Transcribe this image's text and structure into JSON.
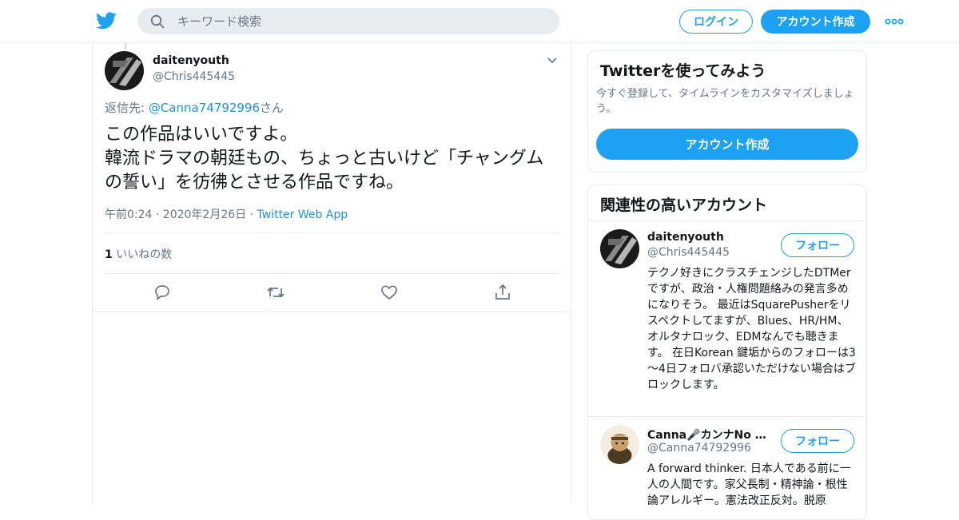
{
  "header": {
    "search_placeholder": "キーワード検索",
    "login_label": "ログイン",
    "signup_label": "アカウント作成"
  },
  "tweet": {
    "author_name": "daitenyouth",
    "author_handle": "@Chris445445",
    "reply_prefix": "返信先: ",
    "reply_mention": "@Canna74792996",
    "reply_suffix": "さん",
    "text": "この作品はいいですよ。\n韓流ドラマの朝廷もの、ちょっと古いけど「チャングムの誓い」を彷彿とさせる作品ですね。",
    "timestamp": "午前0:24 · 2020年2月26日 · ",
    "via": "Twitter Web App",
    "like_count": "1",
    "like_label": " いいねの数"
  },
  "signup_card": {
    "title": "Twitterを使ってみよう",
    "description": "今すぐ登録して、タイムラインをカスタマイズしましょう。",
    "button_label": "アカウント作成"
  },
  "related": {
    "title": "関連性の高いアカウント",
    "accounts": [
      {
        "name": "daitenyouth",
        "handle": "@Chris445445",
        "follow_label": "フォロー",
        "bio": "テクノ好きにクラスチェンジしたDTMerですが、政治・人権問題絡みの発言多めになりそう。 最近はSquarePusherをリスペクトしてますが、Blues、HR/HM、オルタナロック、EDMなんでも聴きます。 在日Korean 鍵垢からのフォローは3～4日フォロバ承認いただけない場合はブロックします。"
      },
      {
        "name": "Canna🎤カンナNo 安倍",
        "handle": "@Canna74792996",
        "follow_label": "フォロー",
        "bio": "A forward thinker. 日本人である前に一人の人間です。家父長制・精神論・根性論アレルギー。憲法改正反対。脱原"
      }
    ]
  },
  "colors": {
    "brand": "#1da1f2",
    "link": "#1b95e0",
    "secondary_text": "#657786",
    "border": "#e6ecf0"
  },
  "icons": [
    "twitter-bird-icon",
    "search-icon",
    "more-dots-icon",
    "chevron-down-icon",
    "reply-icon",
    "retweet-icon",
    "like-icon",
    "share-icon"
  ]
}
